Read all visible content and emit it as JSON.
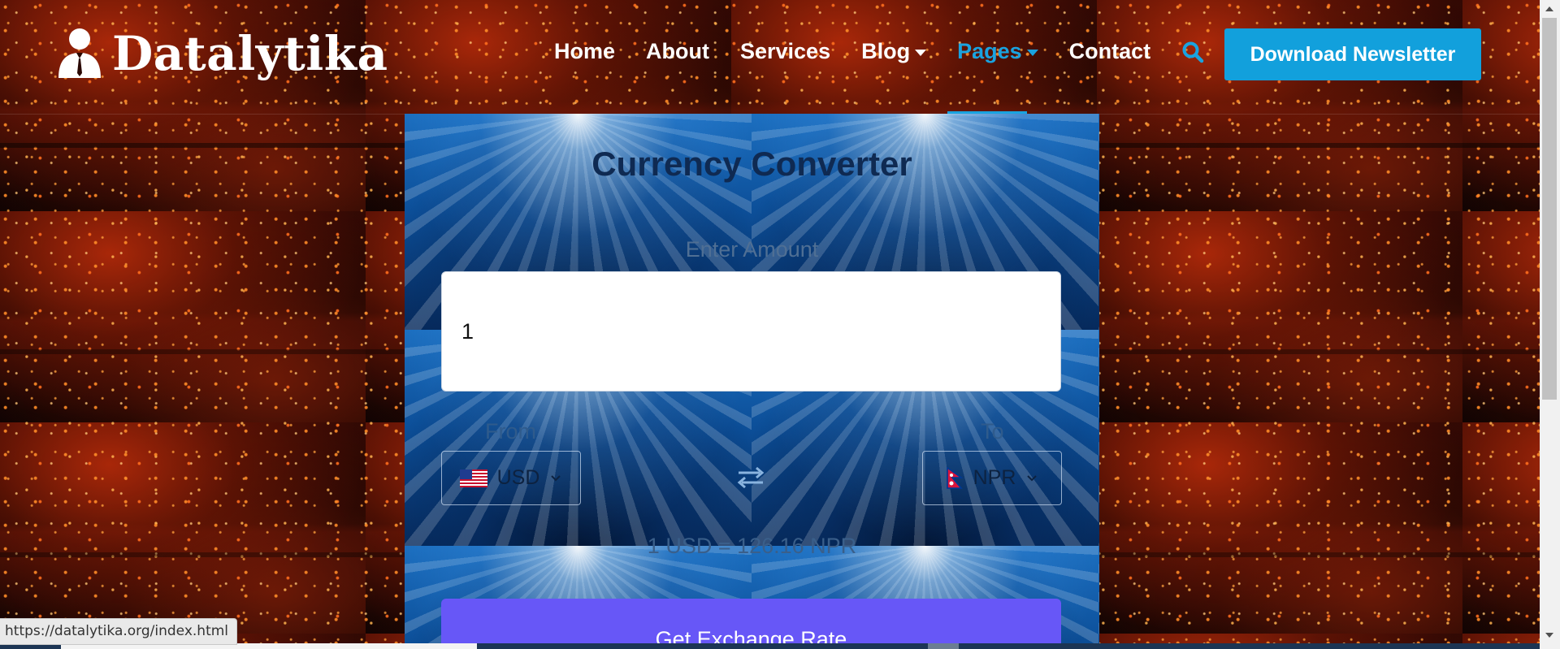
{
  "brand": {
    "name": "Datalytika"
  },
  "nav": {
    "items": [
      {
        "label": "Home"
      },
      {
        "label": "About"
      },
      {
        "label": "Services"
      },
      {
        "label": "Blog",
        "dropdown": true
      },
      {
        "label": "Pages",
        "dropdown": true,
        "active": true
      },
      {
        "label": "Contact"
      }
    ],
    "search_icon": "search-icon"
  },
  "header": {
    "download_label": "Download Newsletter"
  },
  "converter": {
    "title": "Currency Converter",
    "amount_label": "Enter Amount",
    "amount_value": "1",
    "from_label": "From",
    "to_label": "To",
    "from_currency": "USD",
    "to_currency": "NPR",
    "from_flag_icon": "us-flag-icon",
    "to_flag_icon": "nepal-flag-icon",
    "swap_icon": "swap-arrows-icon",
    "rate_text": "1 USD = 126.16 NPR",
    "button_label": "Get Exchange Rate"
  },
  "status_bar": {
    "url": "https://datalytika.org/index.html"
  },
  "colors": {
    "accent": "#1aa3e0",
    "download_button": "#12a0dc",
    "exchange_button": "#6757f7",
    "title_text": "#0f2a52"
  }
}
